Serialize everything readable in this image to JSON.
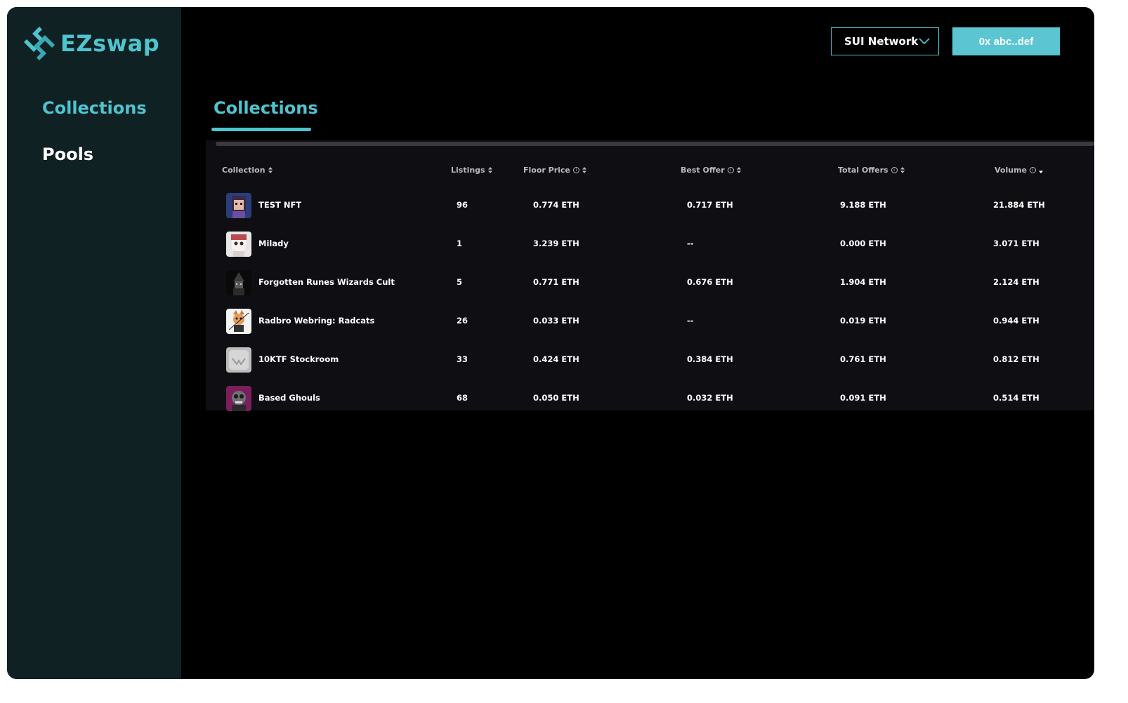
{
  "app": {
    "logo_text": "EZswap",
    "brand_color": "#4fc4cf"
  },
  "sidebar": {
    "items": [
      {
        "label": "Collections",
        "active": true
      },
      {
        "label": "Pools",
        "active": false
      }
    ]
  },
  "header": {
    "network": "SUI Network",
    "wallet": "0x abc..def"
  },
  "tabs": [
    {
      "label": "Collections",
      "active": true
    }
  ],
  "table": {
    "columns": [
      {
        "label": "Collection",
        "info": false,
        "sort": "both"
      },
      {
        "label": "Listings",
        "info": false,
        "sort": "both"
      },
      {
        "label": "Floor Price",
        "info": true,
        "sort": "both"
      },
      {
        "label": "Best Offer",
        "info": true,
        "sort": "both"
      },
      {
        "label": "Total Offers",
        "info": true,
        "sort": "both"
      },
      {
        "label": "Volume",
        "info": true,
        "sort": "desc"
      }
    ],
    "rows": [
      {
        "name": "TEST NFT",
        "listings": "96",
        "floor": "0.774 ETH",
        "best_offer": "0.717 ETH",
        "total_offers": "9.188 ETH",
        "volume": "21.884 ETH",
        "avatar": "pixel-girl-avatar"
      },
      {
        "name": "Milady",
        "listings": "1",
        "floor": "3.239 ETH",
        "best_offer": "--",
        "total_offers": "0.000 ETH",
        "volume": "3.071 ETH",
        "avatar": "milady-avatar"
      },
      {
        "name": "Forgotten Runes Wizards Cult",
        "listings": "5",
        "floor": "0.771 ETH",
        "best_offer": "0.676 ETH",
        "total_offers": "1.904 ETH",
        "volume": "2.124 ETH",
        "avatar": "wizard-avatar"
      },
      {
        "name": "Radbro Webring: Radcats",
        "listings": "26",
        "floor": "0.033 ETH",
        "best_offer": "--",
        "total_offers": "0.019 ETH",
        "volume": "0.944 ETH",
        "avatar": "radcat-avatar"
      },
      {
        "name": "10KTF Stockroom",
        "listings": "33",
        "floor": "0.424 ETH",
        "best_offer": "0.384 ETH",
        "total_offers": "0.761 ETH",
        "volume": "0.812 ETH",
        "avatar": "stockroom-avatar"
      },
      {
        "name": "Based Ghouls",
        "listings": "68",
        "floor": "0.050 ETH",
        "best_offer": "0.032 ETH",
        "total_offers": "0.091 ETH",
        "volume": "0.514 ETH",
        "avatar": "ghoul-avatar"
      }
    ]
  }
}
